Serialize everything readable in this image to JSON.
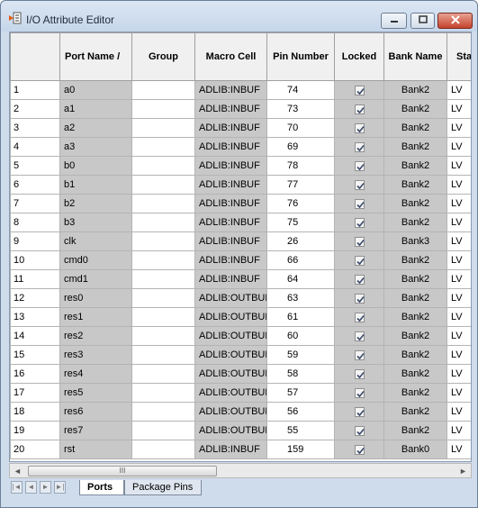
{
  "window": {
    "title": "I/O Attribute Editor",
    "controls": {
      "minimize": "minimize-icon",
      "maximize": "maximize-icon",
      "close": "close-icon"
    }
  },
  "table": {
    "columns": [
      {
        "label": ""
      },
      {
        "label": "Port Name /"
      },
      {
        "label": "Group"
      },
      {
        "label": "Macro Cell"
      },
      {
        "label": "Pin Number"
      },
      {
        "label": "Locked"
      },
      {
        "label": "Bank Name"
      },
      {
        "label": "Sta"
      }
    ],
    "rows": [
      {
        "num": "1",
        "port": "a0",
        "group": "",
        "macro": "ADLIB:INBUF",
        "pin": "74",
        "locked": true,
        "bank": "Bank2",
        "std": "LV"
      },
      {
        "num": "2",
        "port": "a1",
        "group": "",
        "macro": "ADLIB:INBUF",
        "pin": "73",
        "locked": true,
        "bank": "Bank2",
        "std": "LV"
      },
      {
        "num": "3",
        "port": "a2",
        "group": "",
        "macro": "ADLIB:INBUF",
        "pin": "70",
        "locked": true,
        "bank": "Bank2",
        "std": "LV"
      },
      {
        "num": "4",
        "port": "a3",
        "group": "",
        "macro": "ADLIB:INBUF",
        "pin": "69",
        "locked": true,
        "bank": "Bank2",
        "std": "LV"
      },
      {
        "num": "5",
        "port": "b0",
        "group": "",
        "macro": "ADLIB:INBUF",
        "pin": "78",
        "locked": true,
        "bank": "Bank2",
        "std": "LV"
      },
      {
        "num": "6",
        "port": "b1",
        "group": "",
        "macro": "ADLIB:INBUF",
        "pin": "77",
        "locked": true,
        "bank": "Bank2",
        "std": "LV"
      },
      {
        "num": "7",
        "port": "b2",
        "group": "",
        "macro": "ADLIB:INBUF",
        "pin": "76",
        "locked": true,
        "bank": "Bank2",
        "std": "LV"
      },
      {
        "num": "8",
        "port": "b3",
        "group": "",
        "macro": "ADLIB:INBUF",
        "pin": "75",
        "locked": true,
        "bank": "Bank2",
        "std": "LV"
      },
      {
        "num": "9",
        "port": "clk",
        "group": "",
        "macro": "ADLIB:INBUF",
        "pin": "26",
        "locked": true,
        "bank": "Bank3",
        "std": "LV"
      },
      {
        "num": "10",
        "port": "cmd0",
        "group": "",
        "macro": "ADLIB:INBUF",
        "pin": "66",
        "locked": true,
        "bank": "Bank2",
        "std": "LV"
      },
      {
        "num": "11",
        "port": "cmd1",
        "group": "",
        "macro": "ADLIB:INBUF",
        "pin": "64",
        "locked": true,
        "bank": "Bank2",
        "std": "LV"
      },
      {
        "num": "12",
        "port": "res0",
        "group": "",
        "macro": "ADLIB:OUTBUF",
        "pin": "63",
        "locked": true,
        "bank": "Bank2",
        "std": "LV"
      },
      {
        "num": "13",
        "port": "res1",
        "group": "",
        "macro": "ADLIB:OUTBUF",
        "pin": "61",
        "locked": true,
        "bank": "Bank2",
        "std": "LV"
      },
      {
        "num": "14",
        "port": "res2",
        "group": "",
        "macro": "ADLIB:OUTBUF",
        "pin": "60",
        "locked": true,
        "bank": "Bank2",
        "std": "LV"
      },
      {
        "num": "15",
        "port": "res3",
        "group": "",
        "macro": "ADLIB:OUTBUF",
        "pin": "59",
        "locked": true,
        "bank": "Bank2",
        "std": "LV"
      },
      {
        "num": "16",
        "port": "res4",
        "group": "",
        "macro": "ADLIB:OUTBUF",
        "pin": "58",
        "locked": true,
        "bank": "Bank2",
        "std": "LV"
      },
      {
        "num": "17",
        "port": "res5",
        "group": "",
        "macro": "ADLIB:OUTBUF",
        "pin": "57",
        "locked": true,
        "bank": "Bank2",
        "std": "LV"
      },
      {
        "num": "18",
        "port": "res6",
        "group": "",
        "macro": "ADLIB:OUTBUF",
        "pin": "56",
        "locked": true,
        "bank": "Bank2",
        "std": "LV"
      },
      {
        "num": "19",
        "port": "res7",
        "group": "",
        "macro": "ADLIB:OUTBUF",
        "pin": "55",
        "locked": true,
        "bank": "Bank2",
        "std": "LV"
      },
      {
        "num": "20",
        "port": "rst",
        "group": "",
        "macro": "ADLIB:INBUF",
        "pin": "159",
        "locked": true,
        "bank": "Bank0",
        "std": "LV"
      }
    ]
  },
  "scrollbar": {
    "left_arrow": "◄",
    "thumb_grip": "III",
    "right_arrow": "►"
  },
  "tabs": {
    "nav": [
      "|◄",
      "◄",
      "►",
      "►|"
    ],
    "items": [
      {
        "label": "Ports",
        "active": true
      },
      {
        "label": "Package Pins",
        "active": false
      }
    ]
  }
}
